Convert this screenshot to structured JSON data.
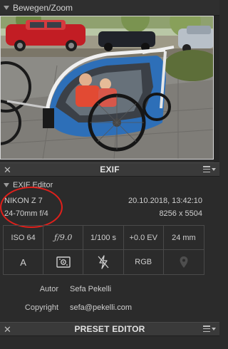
{
  "navigator": {
    "title": "Bewegen/Zoom"
  },
  "exif_panel": {
    "title": "EXIF",
    "close_glyph": "✕",
    "section_label": "EXIF Editor",
    "camera": "NIKON Z 7",
    "datetime": "20.10.2018, 13:42:10",
    "lens": "24-70mm f/4",
    "dimensions": "8256 x 5504",
    "params": {
      "iso": "ISO 64",
      "aperture": "ƒ/9.0",
      "shutter": "1/100 s",
      "exposure": "+0.0 EV",
      "focal": "24 mm",
      "mode": "A",
      "metering_icon": "metering-icon",
      "flash_icon": "flash-off-icon",
      "color": "RGB",
      "location_icon": "location-pin-icon"
    },
    "author_label": "Autor",
    "author_value": "Sefa Pekelli",
    "copyright_label": "Copyright",
    "copyright_value": "sefa@pekelli.com"
  },
  "preset_panel": {
    "title": "PRESET EDITOR",
    "close_glyph": "✕"
  },
  "colors": {
    "highlight": "#e0201b",
    "panel_bg": "#2b2b2b"
  }
}
